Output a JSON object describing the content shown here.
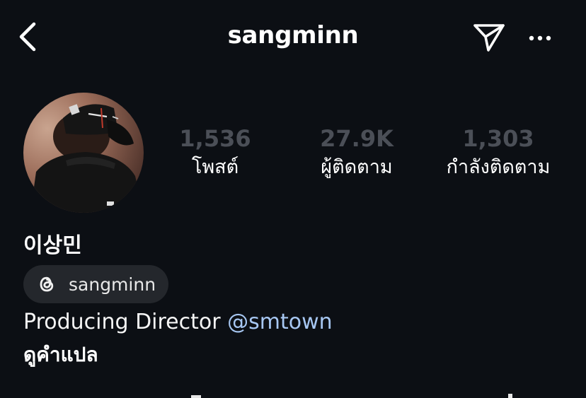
{
  "header": {
    "username": "sangminn",
    "icons": [
      "back-icon",
      "send-icon",
      "more-icon"
    ]
  },
  "profile": {
    "avatar": "profile-photo",
    "stats": {
      "posts": {
        "count": "1,536",
        "label": "โพสต์"
      },
      "followers": {
        "count": "27.9K",
        "label": "ผู้ติดตาม"
      },
      "following": {
        "count": "1,303",
        "label": "กำลังติดตาม"
      }
    },
    "display_name": "이상민",
    "threads": {
      "icon": "threads-icon",
      "handle": "sangminn"
    },
    "bio": {
      "text": "Producing Director ",
      "mention": "@smtown"
    },
    "translate_label": "ดูคำแปล"
  },
  "colors": {
    "background": "#0c0f14",
    "badge": "#24272c",
    "mention": "#a7c7f2",
    "stat_count": "#4b4f57"
  }
}
